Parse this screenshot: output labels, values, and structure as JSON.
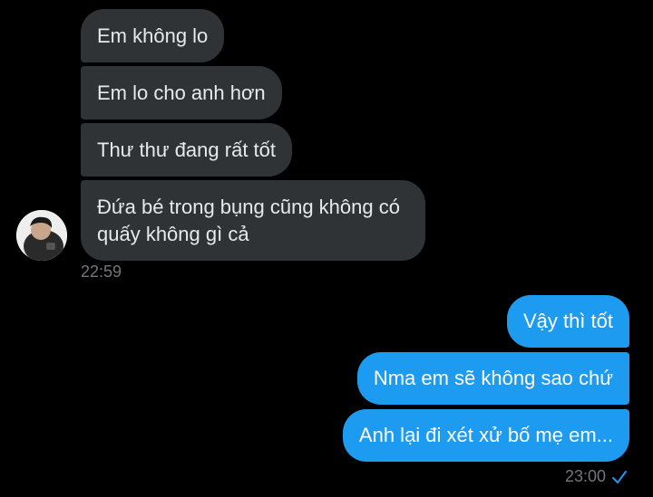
{
  "conversation": {
    "incoming": [
      {
        "text": "Em không lo"
      },
      {
        "text": "Em lo cho anh hơn"
      },
      {
        "text": "Thư thư đang rất tốt"
      },
      {
        "text": "Đứa bé trong bụng cũng không có quấy không gì cả"
      }
    ],
    "incoming_timestamp": "22:59",
    "outgoing": [
      {
        "text": "Vậy thì tốt"
      },
      {
        "text": "Nma em sẽ không sao chứ"
      },
      {
        "text": "Anh lại đi xét xử bố mẹ em..."
      }
    ],
    "outgoing_timestamp": "23:00",
    "outgoing_status": "sent-check-icon"
  },
  "colors": {
    "background": "#000000",
    "incoming_bubble": "#2f3336",
    "outgoing_bubble": "#1d9bf0",
    "timestamp": "#71767b"
  }
}
